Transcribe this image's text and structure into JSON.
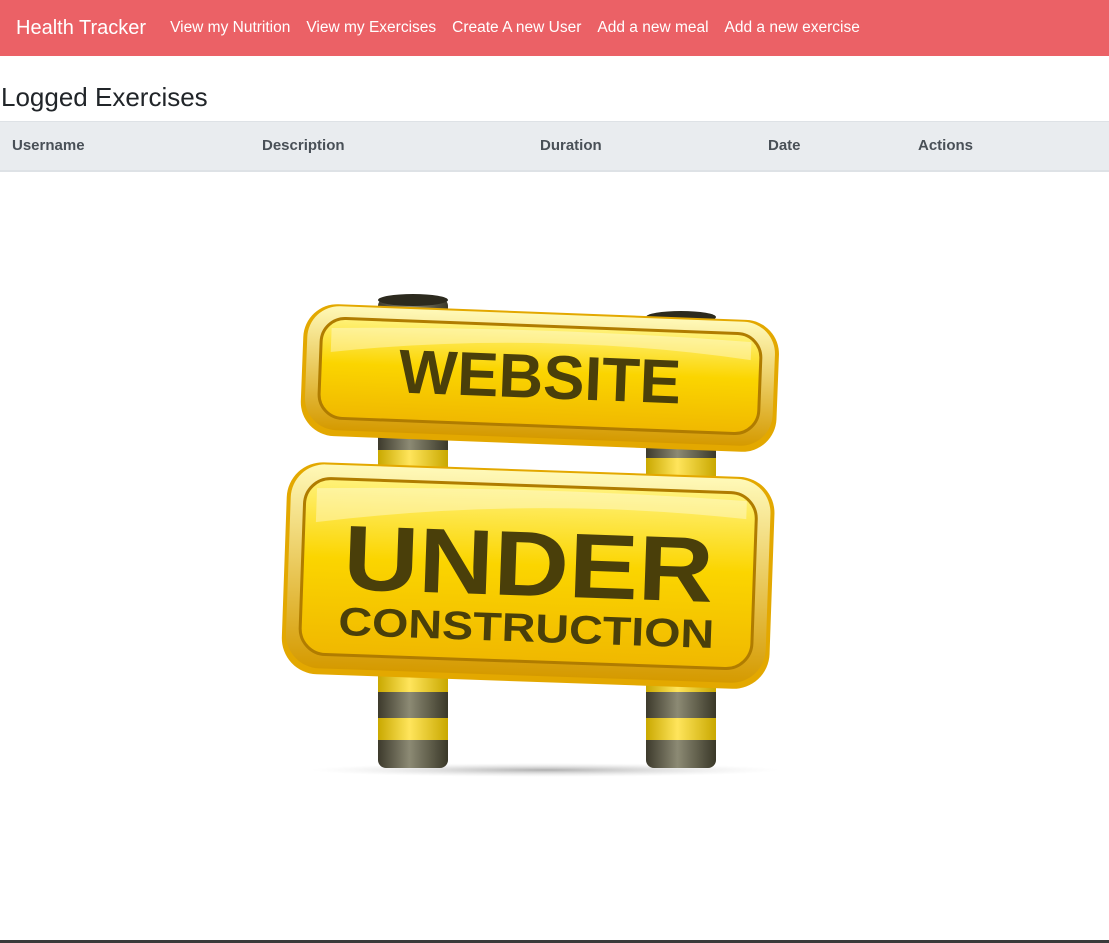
{
  "navbar": {
    "brand": "Health Tracker",
    "links": [
      "View my Nutrition",
      "View my Exercises",
      "Create A new User",
      "Add a new meal",
      "Add a new exercise"
    ],
    "background_color": "#eb6166"
  },
  "main": {
    "title": "Logged Exercises",
    "table": {
      "columns": [
        "Username",
        "Description",
        "Duration",
        "Date",
        "Actions"
      ],
      "rows": []
    }
  },
  "illustration": {
    "icon": "under-construction-sign-icon",
    "sign_top_text": "WEBSITE",
    "sign_big_text": "UNDER",
    "sign_small_text": "CONSTRUCTION",
    "sign_color": "#f7d10a"
  }
}
